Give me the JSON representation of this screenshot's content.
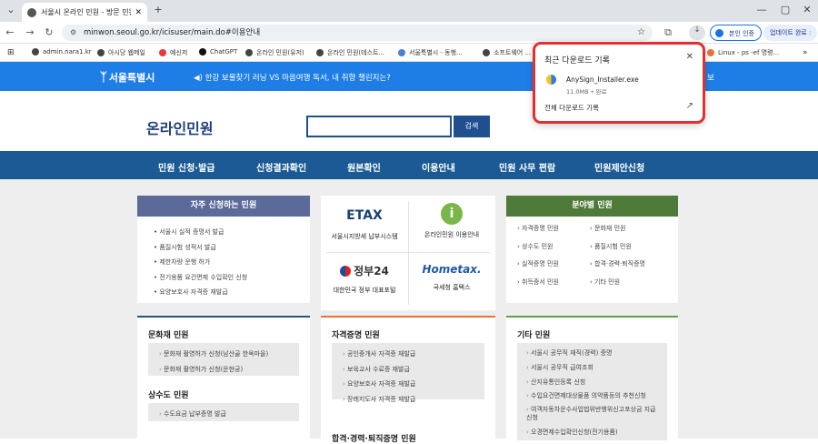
{
  "browser": {
    "tab_title": "서울시 온라인 민원 - 방문 민원 ...",
    "tab_close": "✕",
    "new_tab": "+",
    "window_controls": [
      "⌄",
      "—",
      "▢",
      "✕"
    ],
    "url": "minwon.seoul.go.kr/icisuser/main.do#이용안내",
    "profile_label": "본인 인증",
    "update_label": "업데이트 완료 :",
    "bookmarks": [
      "admin.nara1.kr",
      "아시당 웹메일",
      "예신저",
      "ChatGPT",
      "온라인 민원(유저)",
      "온라인 민원(테스트...",
      "서울특별시 - 동행...",
      "소프트웨어 ...",
      "Linux - ps -ef 명령..."
    ],
    "bookmarks_more": "»"
  },
  "downloads_popup": {
    "title": "최근 다운로드 기록",
    "close": "✕",
    "file_name": "AnySign_Installer.exe",
    "file_meta": "11.0MB • 완료",
    "all_link": "전체 다운로드 기록",
    "open_icon": "↗"
  },
  "site": {
    "logo": "서울특별시",
    "notice": "한강 보물찾기 러닝 VS 마음여행 독서, 내 취향 챌린지는?",
    "notice_tail": "보",
    "title": "온라인민원",
    "search_button": "검색"
  },
  "main_nav": [
    "민원 신청·발급",
    "신청결과확인",
    "원본확인",
    "이용안내",
    "민원 사무 편람",
    "민원제안신청"
  ],
  "frequent": {
    "header": "자주 신청하는 민원",
    "items": [
      "서울시 실적 증명서 발급",
      "품질시험 성적서 발급",
      "제한차량 운행 허가",
      "전기용품 요건면제 수입확인 신청",
      "요양보호사 자격증 재발급"
    ]
  },
  "services": [
    {
      "name": "서울시지방세 납부시스템",
      "logo": "ETAX"
    },
    {
      "name": "온라인민원 이용안내",
      "logo": "i"
    },
    {
      "name": "대한민국 정부 대표포털",
      "logo": "정부24"
    },
    {
      "name": "국세청 홈택스",
      "logo": "Hometax."
    }
  ],
  "by_field": {
    "header": "분야별 민원",
    "col1": [
      "자격증명 민원",
      "상수도 민원",
      "실적증명 민원",
      "취득증서 민원"
    ],
    "col2": [
      "문화재 민원",
      "품질시험 민원",
      "합격·경력·퇴직증명",
      "기타 민원"
    ]
  },
  "culture": {
    "title": "문화재 민원",
    "items": [
      "문화재 촬영허가 신청(남산골 한옥마을)",
      "문화재 촬영허가 신청(운현궁)"
    ]
  },
  "water": {
    "title": "상수도 민원",
    "items": [
      "수도요금 납부증명 발급"
    ]
  },
  "license": {
    "title": "자격증명 민원",
    "items": [
      "공인중개사 자격증 재발급",
      "보육교사 수료증 재발급",
      "요양보호사 자격증 재발급",
      "장례지도사 자격증 재발급"
    ]
  },
  "career": {
    "title": "합격·경력·퇴직증명 민원"
  },
  "other": {
    "title": "기타 민원",
    "items": [
      "서울시 공무직 재직(경력) 증명",
      "서울시 공무직 급여조회",
      "산지유통인등록 신청",
      "수입요건면제대상물품 의약품등의 추천신청",
      "여객자동차운수사업법위반행위신고포상금 지급신청",
      "오경면제수입확인신청(전기용품)"
    ]
  },
  "colors": {
    "blue_bar": "#1e7ee6",
    "nav": "#1b5a94",
    "frequent_header": "#5c6a9a",
    "field_header": "#4e7a3a",
    "accent_orange": "#e8743b",
    "accent_green": "#5fa04a"
  }
}
